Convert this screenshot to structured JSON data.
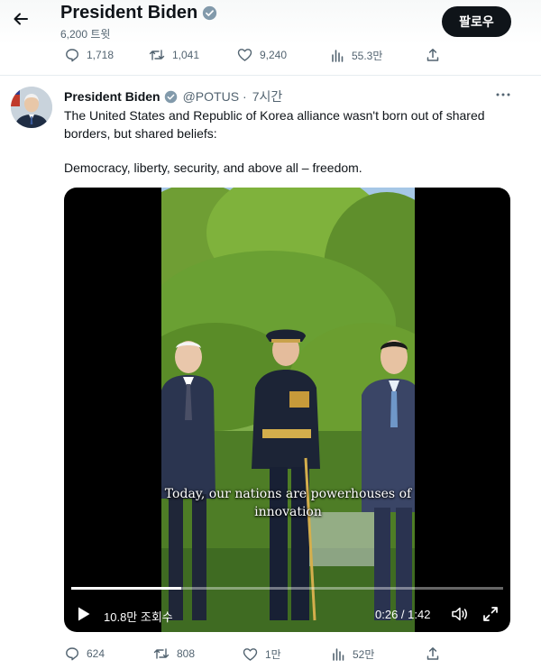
{
  "header": {
    "title": "President Biden",
    "tweet_count": "6,200 트윗",
    "follow_label": "팔로우",
    "back_icon": "arrow-left-icon"
  },
  "prev_tweet_actions": {
    "replies": "1,718",
    "retweets": "1,041",
    "likes": "9,240",
    "views": "55.3만"
  },
  "tweet": {
    "author_name": "President Biden",
    "handle": "@POTUS",
    "separator": "·",
    "time": "7시간",
    "text_line_1": "The United States and Republic of Korea alliance wasn't born out of shared borders, but shared beliefs:",
    "text_line_2": "Democracy, liberty, security, and above all – freedom.",
    "video": {
      "caption": "Today, our nations are powerhouses of innovation",
      "views_label": "10.8만 조회수",
      "time": "0:26 / 1:42",
      "progress": 0.254
    },
    "actions": {
      "replies": "624",
      "retweets": "808",
      "likes": "1만",
      "views": "52만"
    }
  },
  "colors": {
    "text": "#0f1419",
    "secondary": "#536471",
    "verified": "#829aab",
    "follow_bg": "#0f1419",
    "video_bg": "#000000"
  }
}
